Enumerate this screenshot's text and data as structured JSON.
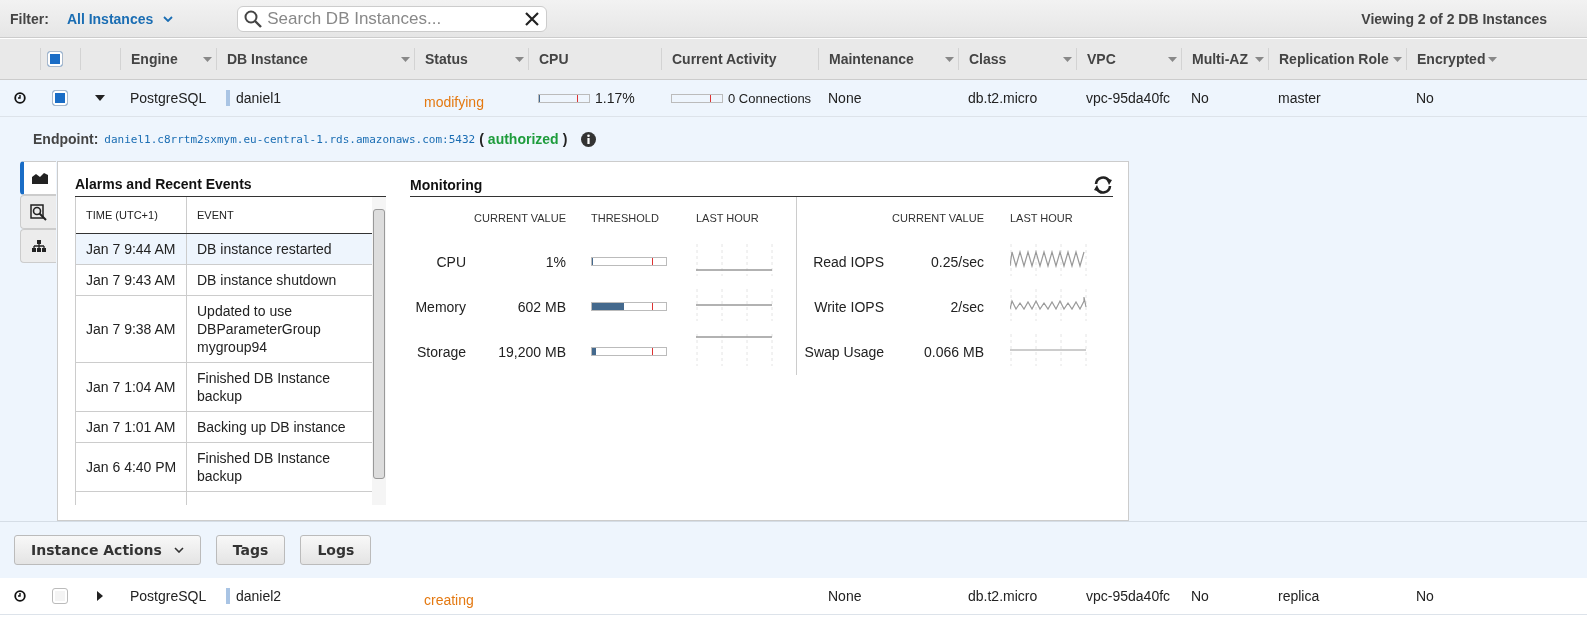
{
  "filter": {
    "label": "Filter:",
    "value": "All Instances"
  },
  "search": {
    "placeholder": "Search DB Instances..."
  },
  "viewing": "Viewing 2 of 2 DB Instances",
  "table": {
    "all_checked": true,
    "columns": [
      "Engine",
      "DB Instance",
      "Status",
      "CPU",
      "Current Activity",
      "Maintenance",
      "Class",
      "VPC",
      "Multi-AZ",
      "Replication Role",
      "Encrypted"
    ],
    "rows": [
      {
        "selected": true,
        "checked": true,
        "expanded": true,
        "engine": "PostgreSQL",
        "instance": "daniel1",
        "status": "modifying",
        "cpu": {
          "level": 0.012,
          "reading": "1.17%"
        },
        "activity": {
          "reading": "0 Connections"
        },
        "maintenance": "None",
        "class": "db.t2.micro",
        "vpc": "vpc-95da40fc",
        "multi_az": "No",
        "role": "master",
        "encrypted": "No"
      },
      {
        "selected": false,
        "checked": false,
        "expanded": false,
        "engine": "PostgreSQL",
        "instance": "daniel2",
        "status": "creating",
        "maintenance": "None",
        "class": "db.t2.micro",
        "vpc": "vpc-95da40fc",
        "multi_az": "No",
        "role": "replica",
        "encrypted": "No"
      }
    ]
  },
  "details": {
    "endpoint": {
      "label": "Endpoint:",
      "address": "daniel1.c8rrtm2sxmym.eu-central-1.rds.amazonaws.com:5432",
      "paren_open": "(",
      "status": "authorized",
      "paren_close": ")"
    },
    "side_tabs": [
      {
        "kind": "chart",
        "selected": true
      },
      {
        "kind": "search",
        "selected": false
      },
      {
        "kind": "hierarchy",
        "selected": false
      }
    ],
    "events": {
      "title": "Alarms and Recent Events",
      "columns": [
        "TIME (UTC+1)",
        "EVENT"
      ],
      "rows": [
        {
          "time": "Jan 7 9:44 AM",
          "event": "DB instance restarted",
          "selected": true
        },
        {
          "time": "Jan 7 9:43 AM",
          "event": "DB instance shutdown",
          "selected": false
        },
        {
          "time": "Jan 7 9:38 AM",
          "event": "Updated to use DBParameterGroup mygroup94",
          "selected": false
        },
        {
          "time": "Jan 7 1:04 AM",
          "event": "Finished DB Instance backup",
          "selected": false
        },
        {
          "time": "Jan 7 1:01 AM",
          "event": "Backing up DB instance",
          "selected": false
        },
        {
          "time": "Jan 6 4:40 PM",
          "event": "Finished DB Instance backup",
          "selected": false
        }
      ]
    },
    "monitoring": {
      "title": "Monitoring",
      "left_columns": [
        "CURRENT VALUE",
        "THRESHOLD",
        "LAST HOUR"
      ],
      "left": [
        {
          "name": "CPU",
          "value": "1%",
          "level": 0.01,
          "kind": "low"
        },
        {
          "name": "Memory",
          "value": "602 MB",
          "level": 0.43,
          "kind": "mid"
        },
        {
          "name": "Storage",
          "value": "19,200 MB",
          "level": 0.06,
          "kind": "high"
        }
      ],
      "right_columns": [
        "CURRENT VALUE",
        "LAST HOUR"
      ],
      "right": [
        {
          "name": "Read IOPS",
          "value": "0.25/sec",
          "kind": "spiky"
        },
        {
          "name": "Write IOPS",
          "value": "2/sec",
          "kind": "wavy"
        },
        {
          "name": "Swap Usage",
          "value": "0.066 MB",
          "kind": "mid"
        }
      ]
    }
  },
  "buttons": [
    {
      "label": "Instance Actions",
      "kind": "dropdown"
    },
    {
      "label": "Tags",
      "kind": "plain"
    },
    {
      "label": "Logs",
      "kind": "plain"
    }
  ]
}
